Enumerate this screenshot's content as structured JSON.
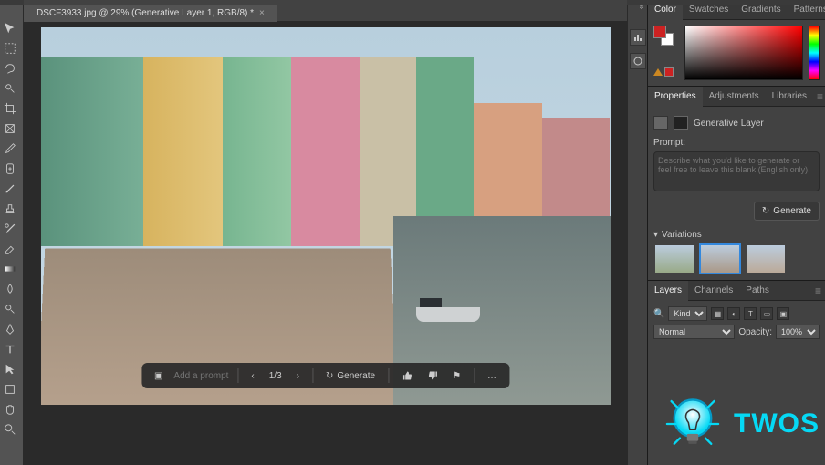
{
  "document": {
    "tab_title": "DSCF3933.jpg @ 29% (Generative Layer 1, RGB/8) *",
    "close_glyph": "×"
  },
  "context_bar": {
    "prompt_placeholder": "Add a prompt...",
    "page_indicator": "1/3",
    "generate_label": "Generate"
  },
  "color_panel": {
    "tabs": [
      "Color",
      "Swatches",
      "Gradients",
      "Patterns"
    ],
    "active_tab": 0,
    "foreground": "#cc2222",
    "background": "#ffffff",
    "warn_color": "#cc2222"
  },
  "properties_panel": {
    "tabs": [
      "Properties",
      "Adjustments",
      "Libraries"
    ],
    "active_tab": 0,
    "layer_type": "Generative Layer",
    "prompt_label": "Prompt:",
    "prompt_placeholder": "Describe what you'd like to generate or feel free to leave this blank (English only).",
    "generate_label": "Generate",
    "variations_label": "Variations",
    "variation_count": 3,
    "selected_variation": 1
  },
  "layers_panel": {
    "tabs": [
      "Layers",
      "Channels",
      "Paths"
    ],
    "active_tab": 0,
    "filter_label": "Kind",
    "blend_mode": "Normal",
    "opacity_label": "Opacity:",
    "opacity_value": "100%"
  },
  "tools": [
    "move-tool",
    "marquee-tool",
    "lasso-tool",
    "quick-select-tool",
    "crop-tool",
    "frame-tool",
    "eyedropper-tool",
    "healing-tool",
    "brush-tool",
    "stamp-tool",
    "history-brush-tool",
    "eraser-tool",
    "gradient-tool",
    "blur-tool",
    "dodge-tool",
    "pen-tool",
    "type-tool",
    "path-select-tool",
    "shape-tool",
    "hand-tool",
    "zoom-tool",
    "edit-toolbar"
  ],
  "icons": {
    "chevron_left": "‹",
    "chevron_right": "›",
    "refresh": "↻",
    "thumbs_up": "👍",
    "thumbs_down": "👎",
    "flag": "⚑",
    "more": "…",
    "chevron_down": "▾",
    "search": "🔍"
  },
  "watermark": {
    "text": "TWOS"
  }
}
